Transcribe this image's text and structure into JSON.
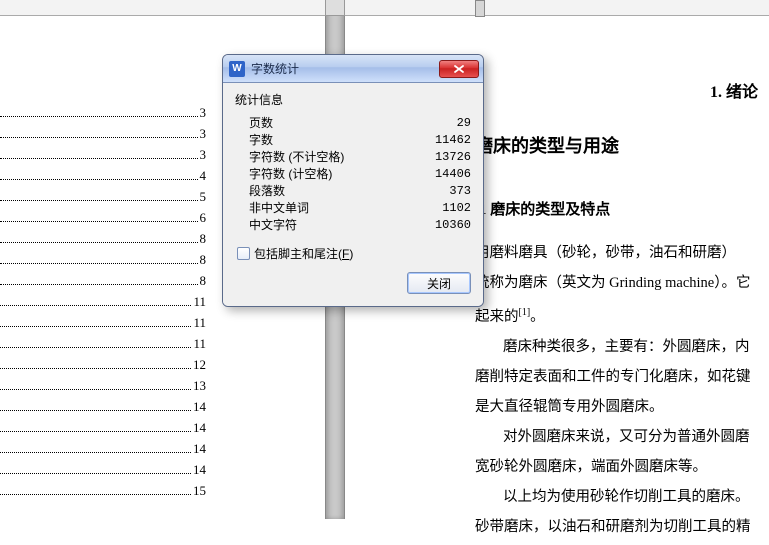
{
  "toc": {
    "items": [
      {
        "page": "3"
      },
      {
        "page": "3"
      },
      {
        "page": "3"
      },
      {
        "page": "4"
      },
      {
        "page": "5"
      },
      {
        "page": "6"
      },
      {
        "page": "8"
      },
      {
        "page": "8"
      },
      {
        "page": "8"
      },
      {
        "page": "11"
      },
      {
        "page": "11"
      },
      {
        "page": "11"
      },
      {
        "page": "12"
      },
      {
        "page": "13"
      },
      {
        "page": "14"
      },
      {
        "page": "14"
      },
      {
        "page": "14"
      },
      {
        "page": "14"
      },
      {
        "page": "15"
      }
    ]
  },
  "document": {
    "section_number": "1. 绪论",
    "heading1": "磨床的类型与用途",
    "heading2": "1 磨床的类型及特点",
    "p1": "用磨料磨具（砂轮，砂带，油石和研磨）",
    "p2": "统称为磨床（英文为 Grinding machine）。它",
    "p3_pre": "起来的",
    "p3_ref": "[1]",
    "p3_post": "。",
    "p4": "磨床种类很多，主要有：外圆磨床，内",
    "p5": "磨削特定表面和工件的专门化磨床，如花键",
    "p6": "是大直径辊筒专用外圆磨床。",
    "p7": "对外圆磨床来说，又可分为普通外圆磨",
    "p8": "宽砂轮外圆磨床，端面外圆磨床等。",
    "p9": "以上均为使用砂轮作切削工具的磨床。",
    "p10": "砂带磨床，以油石和研磨剂为切削工具的精"
  },
  "dialog": {
    "app_icon": "W",
    "title": "字数统计",
    "group_title": "统计信息",
    "rows": [
      {
        "label": "页数",
        "value": "29"
      },
      {
        "label": "字数",
        "value": "11462"
      },
      {
        "label": "字符数 (不计空格)",
        "value": "13726"
      },
      {
        "label": "字符数 (计空格)",
        "value": "14406"
      },
      {
        "label": "段落数",
        "value": "373"
      },
      {
        "label": "非中文单词",
        "value": "1102"
      },
      {
        "label": "中文字符",
        "value": "10360"
      }
    ],
    "checkbox_label_pre": "包括脚主和尾注(",
    "checkbox_accel": "F",
    "checkbox_label_post": ")",
    "close_button": "关闭"
  }
}
